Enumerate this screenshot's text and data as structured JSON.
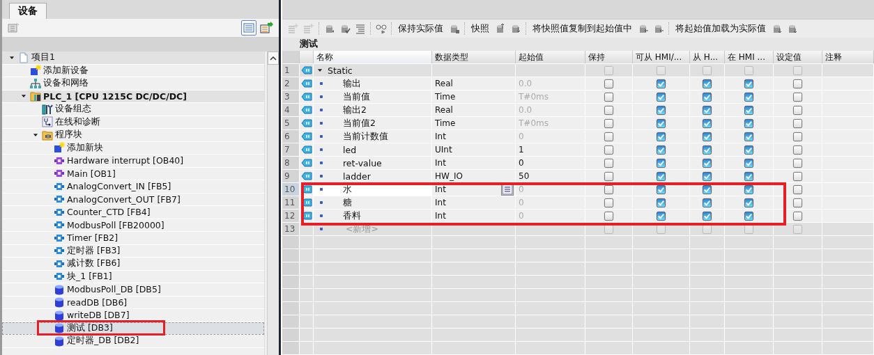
{
  "left_panel": {
    "tab": {
      "label": "设备",
      "selected": true
    },
    "tree": [
      {
        "label": "项目1",
        "kind": "project",
        "expanded": true,
        "selected": false,
        "children": [
          {
            "label": "添加新设备",
            "kind": "add",
            "selected": false
          },
          {
            "label": "设备和网络",
            "kind": "network",
            "selected": false
          },
          {
            "label": "PLC_1 [CPU 1215C DC/DC/DC]",
            "kind": "plc",
            "expanded": true,
            "selected": false,
            "children": [
              {
                "label": "设备组态",
                "kind": "config",
                "selected": false
              },
              {
                "label": "在线和诊断",
                "kind": "diag",
                "selected": false
              },
              {
                "label": "程序块",
                "kind": "folder",
                "expanded": true,
                "selected": false,
                "children": [
                  {
                    "label": "添加新块",
                    "kind": "add",
                    "selected": false
                  },
                  {
                    "label": "Hardware interrupt [OB40]",
                    "kind": "ob",
                    "selected": false
                  },
                  {
                    "label": "Main [OB1]",
                    "kind": "ob",
                    "selected": false
                  },
                  {
                    "label": "AnalogConvert_IN [FB5]",
                    "kind": "fb",
                    "selected": false
                  },
                  {
                    "label": "AnalogConvert_OUT [FB7]",
                    "kind": "fb",
                    "selected": false
                  },
                  {
                    "label": "Counter_CTD [FB4]",
                    "kind": "fb",
                    "selected": false
                  },
                  {
                    "label": "ModbusPoll [FB20000]",
                    "kind": "fb",
                    "selected": false
                  },
                  {
                    "label": "Timer [FB2]",
                    "kind": "fb",
                    "selected": false
                  },
                  {
                    "label": "定时器 [FB3]",
                    "kind": "fb",
                    "selected": false
                  },
                  {
                    "label": "减计数 [FB6]",
                    "kind": "fb",
                    "selected": false
                  },
                  {
                    "label": "块_1 [FB1]",
                    "kind": "fb",
                    "selected": false
                  },
                  {
                    "label": "ModbusPoll_DB [DB5]",
                    "kind": "db",
                    "selected": false
                  },
                  {
                    "label": "readDB [DB6]",
                    "kind": "db",
                    "selected": false
                  },
                  {
                    "label": "writeDB [DB7]",
                    "kind": "db",
                    "selected": false
                  },
                  {
                    "label": "测试 [DB3]",
                    "kind": "db",
                    "selected": true
                  },
                  {
                    "label": "定时器_DB [DB2]",
                    "kind": "db",
                    "selected": false
                  }
                ]
              }
            ]
          }
        ]
      }
    ]
  },
  "editor": {
    "toolbar": [
      "保持实际值",
      "快照",
      "将快照值复制到起始值中",
      "将起始值加载为实际值"
    ],
    "title": "测试",
    "columns": [
      "名称",
      "数据类型",
      "起始值",
      "保持",
      "可从 HMI/...",
      "从 H...",
      "在 HMI ...",
      "设定值",
      "注释"
    ],
    "rows": [
      {
        "kind": "section",
        "num": "1",
        "name": "Static",
        "expanded": true,
        "flags": [
          false,
          false,
          false,
          false,
          false
        ]
      },
      {
        "kind": "var",
        "num": "2",
        "name": "输出",
        "type": "Real",
        "start": "0.0",
        "default": true,
        "flags": [
          false,
          true,
          true,
          true,
          false
        ]
      },
      {
        "kind": "var",
        "num": "3",
        "name": "当前值",
        "type": "Time",
        "start": "T#0ms",
        "default": true,
        "flags": [
          false,
          true,
          true,
          true,
          false
        ]
      },
      {
        "kind": "var",
        "num": "4",
        "name": "输出2",
        "type": "Real",
        "start": "0.0",
        "default": true,
        "flags": [
          false,
          true,
          true,
          true,
          false
        ]
      },
      {
        "kind": "var",
        "num": "5",
        "name": "当前值2",
        "type": "Time",
        "start": "T#0ms",
        "default": true,
        "flags": [
          false,
          true,
          true,
          true,
          false
        ]
      },
      {
        "kind": "var",
        "num": "6",
        "name": "当前计数值",
        "type": "Int",
        "start": "0",
        "default": true,
        "flags": [
          false,
          true,
          true,
          true,
          false
        ]
      },
      {
        "kind": "var",
        "num": "7",
        "name": "led",
        "type": "UInt",
        "start": "1",
        "default": false,
        "flags": [
          false,
          true,
          true,
          true,
          false
        ]
      },
      {
        "kind": "var",
        "num": "8",
        "name": "ret-value",
        "type": "Int",
        "start": "0",
        "default": false,
        "flags": [
          false,
          true,
          true,
          true,
          false
        ]
      },
      {
        "kind": "var",
        "num": "9",
        "name": "ladder",
        "type": "HW_IO",
        "start": "50",
        "default": false,
        "flags": [
          false,
          true,
          true,
          true,
          false
        ]
      },
      {
        "kind": "var",
        "num": "10",
        "name": "水",
        "type": "Int",
        "start": "0",
        "default": true,
        "editing": true,
        "flags": [
          false,
          true,
          true,
          true,
          false
        ]
      },
      {
        "kind": "var",
        "num": "11",
        "name": "糖",
        "type": "Int",
        "start": "0",
        "default": true,
        "flags": [
          false,
          true,
          true,
          true,
          false
        ]
      },
      {
        "kind": "var",
        "num": "12",
        "name": "香料",
        "type": "Int",
        "start": "0",
        "default": true,
        "flags": [
          false,
          true,
          true,
          true,
          false
        ]
      },
      {
        "kind": "add",
        "num": "13",
        "name": "<新增>",
        "flags": [
          false,
          false,
          false,
          false,
          false
        ]
      }
    ]
  }
}
